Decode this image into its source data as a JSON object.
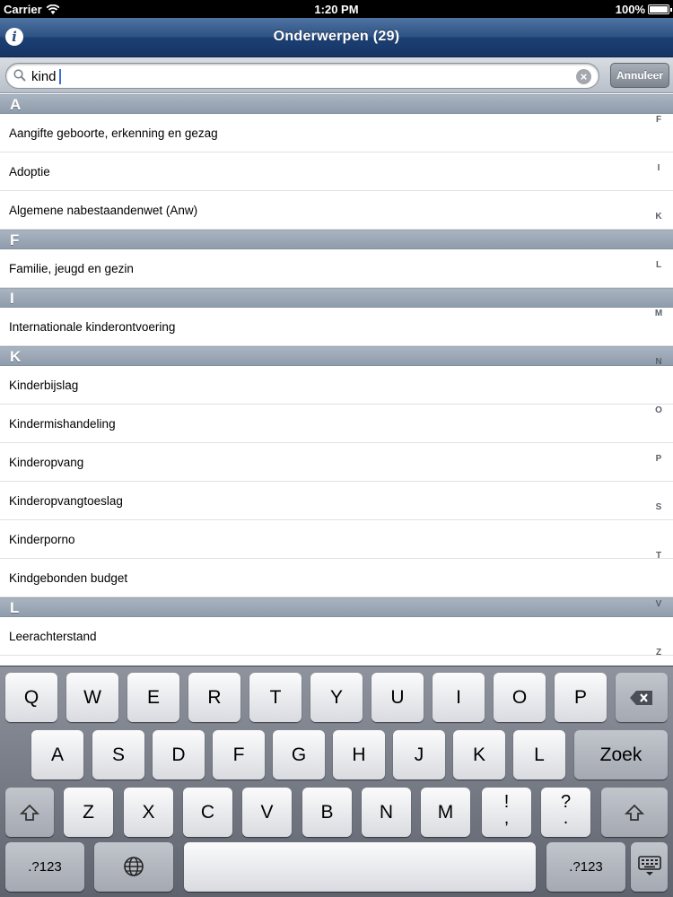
{
  "status_bar": {
    "carrier": "Carrier",
    "time": "1:20 PM",
    "battery": "100%"
  },
  "nav": {
    "title": "Onderwerpen (29)"
  },
  "search": {
    "value": "kind",
    "cancel_label": "Annuleer"
  },
  "sections": [
    {
      "letter": "A",
      "items": [
        "Aangifte geboorte, erkenning en gezag",
        "Adoptie",
        "Algemene nabestaandenwet (Anw)"
      ]
    },
    {
      "letter": "F",
      "items": [
        "Familie, jeugd en gezin"
      ]
    },
    {
      "letter": "I",
      "items": [
        "Internationale kinderontvoering"
      ]
    },
    {
      "letter": "K",
      "items": [
        "Kinderbijslag",
        "Kindermishandeling",
        "Kinderopvang",
        "Kinderopvangtoeslag",
        "Kinderporno",
        "Kindgebonden budget"
      ]
    },
    {
      "letter": "L",
      "items": [
        "Leerachterstand"
      ]
    }
  ],
  "index": [
    "A",
    "F",
    "I",
    "K",
    "L",
    "M",
    "N",
    "O",
    "P",
    "S",
    "T",
    "V",
    "Z"
  ],
  "keyboard": {
    "row1": [
      "Q",
      "W",
      "E",
      "R",
      "T",
      "Y",
      "U",
      "I",
      "O",
      "P"
    ],
    "row2": [
      "A",
      "S",
      "D",
      "F",
      "G",
      "H",
      "J",
      "K",
      "L"
    ],
    "row3": [
      "Z",
      "X",
      "C",
      "V",
      "B",
      "N",
      "M"
    ],
    "punct1": [
      "!",
      ","
    ],
    "punct2": [
      "?",
      "."
    ],
    "return_label": "Zoek",
    "numbers_label": ".?123",
    "icons": {
      "backspace": "backspace-icon",
      "shift": "shift-icon",
      "globe": "globe-icon",
      "hide": "keyboard-hide-icon"
    }
  }
}
